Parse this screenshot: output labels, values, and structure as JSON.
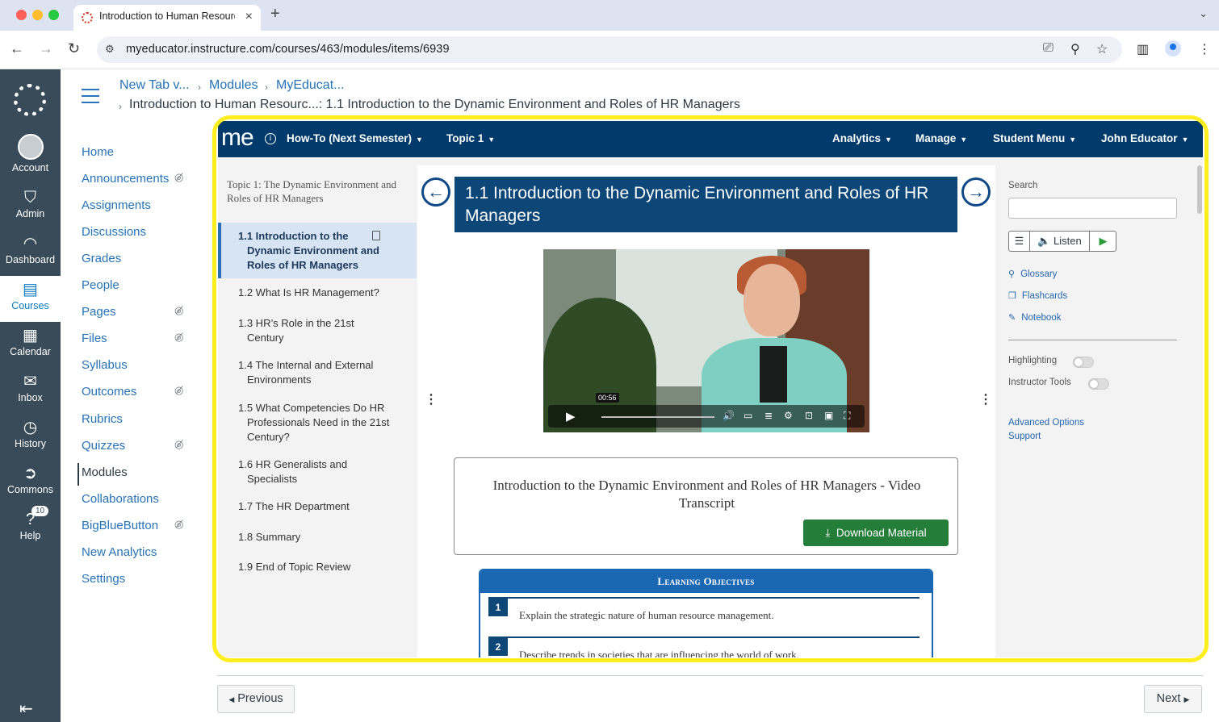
{
  "browser": {
    "tab_title": "Introduction to Human Resources",
    "url": "myeducator.instructure.com/courses/463/modules/items/6939"
  },
  "global_nav": {
    "items": [
      {
        "label": "Account",
        "icon": "user-avatar-icon"
      },
      {
        "label": "Admin",
        "icon": "shield-icon"
      },
      {
        "label": "Dashboard",
        "icon": "speedometer-icon"
      },
      {
        "label": "Courses",
        "icon": "book-icon",
        "active": true
      },
      {
        "label": "Calendar",
        "icon": "calendar-icon"
      },
      {
        "label": "Inbox",
        "icon": "inbox-icon"
      },
      {
        "label": "History",
        "icon": "clock-icon"
      },
      {
        "label": "Commons",
        "icon": "commons-arrow-icon"
      },
      {
        "label": "Help",
        "icon": "help-icon",
        "badge": "10"
      }
    ]
  },
  "breadcrumb": {
    "items": [
      "New Tab v...",
      "Modules",
      "MyEducat..."
    ],
    "current": "Introduction to Human Resourc...: 1.1 Introduction to the Dynamic Environment and Roles of HR Managers"
  },
  "course_nav": {
    "items": [
      {
        "label": "Home",
        "hidden": false
      },
      {
        "label": "Announcements",
        "hidden": true
      },
      {
        "label": "Assignments",
        "hidden": false
      },
      {
        "label": "Discussions",
        "hidden": false
      },
      {
        "label": "Grades",
        "hidden": false
      },
      {
        "label": "People",
        "hidden": false
      },
      {
        "label": "Pages",
        "hidden": true
      },
      {
        "label": "Files",
        "hidden": true
      },
      {
        "label": "Syllabus",
        "hidden": false
      },
      {
        "label": "Outcomes",
        "hidden": true
      },
      {
        "label": "Rubrics",
        "hidden": false
      },
      {
        "label": "Quizzes",
        "hidden": true
      },
      {
        "label": "Modules",
        "hidden": false,
        "active": true
      },
      {
        "label": "Collaborations",
        "hidden": false
      },
      {
        "label": "BigBlueButton",
        "hidden": true
      },
      {
        "label": "New Analytics",
        "hidden": false
      },
      {
        "label": "Settings",
        "hidden": false
      }
    ]
  },
  "me_header": {
    "logo": "me",
    "menus": [
      "How-To (Next Semester)",
      "Topic 1",
      "Analytics",
      "Manage",
      "Student Menu",
      "John Educator"
    ]
  },
  "toc": {
    "heading": "Topic 1: The Dynamic Environment and Roles of HR Managers",
    "items": [
      "1.1 Introduction to the Dynamic Environment and Roles of HR Managers",
      "1.2 What Is HR Management?",
      "1.3 HR’s Role in the 21st Century",
      "1.4 The Internal and External Environments",
      "1.5 What Competencies Do HR Professionals Need in the 21st Century?",
      "1.6 HR Generalists and Specialists",
      "1.7 The HR Department",
      "1.8 Summary",
      "1.9 End of Topic Review"
    ]
  },
  "content": {
    "section_title": "1.1  Introduction to the Dynamic Environment and Roles of HR Managers",
    "video_time": "00:56",
    "transcript_title": "Introduction to the Dynamic Environment and Roles of HR Managers - Video Transcript",
    "download_label": "Download Material",
    "objectives_header": "Learning Objectives",
    "objectives": [
      {
        "num": "1",
        "text": "Explain the strategic nature of human resource management."
      },
      {
        "num": "2",
        "text": "Describe trends in societies that are influencing the world of work."
      }
    ]
  },
  "tools": {
    "search_label": "Search",
    "listen_label": "Listen",
    "links": [
      "Glossary",
      "Flashcards",
      "Notebook"
    ],
    "toggles": [
      "Highlighting",
      "Instructor Tools"
    ],
    "highlighting_on": false,
    "instructor_tools_on": false,
    "bottom_links": [
      "Advanced Options",
      "Support"
    ]
  },
  "pager": {
    "previous": "Previous",
    "next": "Next"
  },
  "colors": {
    "canvas_nav": "#394b58",
    "me_blue": "#003b6b",
    "download_green": "#257d3a",
    "highlight": "#ffee1e"
  }
}
